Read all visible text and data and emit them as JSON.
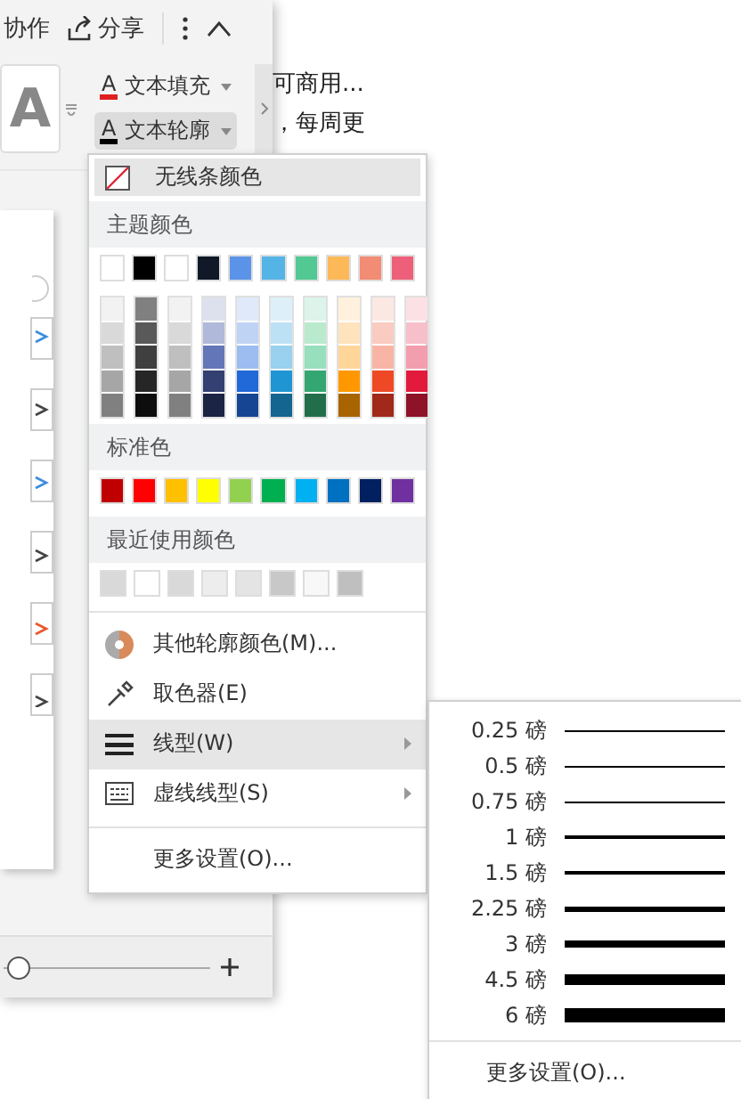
{
  "toolbar": {
    "collab": "协作",
    "share": "分享"
  },
  "text_buttons": [
    {
      "icon": "A",
      "label": "文本填充",
      "color": "#e02020",
      "pressed": false
    },
    {
      "icon": "A",
      "label": "文本轮廓",
      "color": "#000000",
      "pressed": true
    }
  ],
  "preview_glyph": "A",
  "zoom": {
    "level": 0.02
  },
  "background_text": [
    "可商用...",
    "，每周更"
  ],
  "color_menu": {
    "no_line": "无线条颜色",
    "theme_header": "主题颜色",
    "theme_colors": [
      {
        "color": "#ffffff"
      },
      {
        "color": "#000000"
      },
      {
        "color": "#ffffff"
      },
      {
        "color": "#111827"
      },
      {
        "color": "#5b93e8"
      },
      {
        "color": "#55b4e6"
      },
      {
        "color": "#52c892"
      },
      {
        "color": "#fdb857"
      },
      {
        "color": "#f28c74"
      },
      {
        "color": "#ee6079"
      }
    ],
    "shades": [
      [
        {
          "color": "#f2f2f2"
        },
        {
          "color": "#d9d9d9"
        },
        {
          "color": "#bfbfbf"
        },
        {
          "color": "#a6a6a6"
        },
        {
          "color": "#808080"
        }
      ],
      [
        {
          "color": "#808080"
        },
        {
          "color": "#595959"
        },
        {
          "color": "#3f3f3f"
        },
        {
          "color": "#262626"
        },
        {
          "color": "#0d0d0d"
        }
      ],
      [
        {
          "color": "#f2f2f2"
        },
        {
          "color": "#d9d9d9"
        },
        {
          "color": "#bfbfbf"
        },
        {
          "color": "#a6a6a6"
        },
        {
          "color": "#808080"
        }
      ],
      [
        {
          "color": "#dde1ee"
        },
        {
          "color": "#b0b9d9"
        },
        {
          "color": "#6276b8"
        },
        {
          "color": "#334071"
        },
        {
          "color": "#1c2444"
        }
      ],
      [
        {
          "color": "#dfe9f9"
        },
        {
          "color": "#bfd3f5"
        },
        {
          "color": "#9dbdf0"
        },
        {
          "color": "#2168d8"
        },
        {
          "color": "#164594"
        }
      ],
      [
        {
          "color": "#ddf0fa"
        },
        {
          "color": "#bce1f4"
        },
        {
          "color": "#99d1ef"
        },
        {
          "color": "#1f95d3"
        },
        {
          "color": "#146590"
        }
      ],
      [
        {
          "color": "#dcf4e9"
        },
        {
          "color": "#baeace"
        },
        {
          "color": "#97dfbd"
        },
        {
          "color": "#34a672"
        },
        {
          "color": "#226e4b"
        }
      ],
      [
        {
          "color": "#fff1dd"
        },
        {
          "color": "#ffe3bc"
        },
        {
          "color": "#ffd59a"
        },
        {
          "color": "#ff9800"
        },
        {
          "color": "#a86400"
        }
      ],
      [
        {
          "color": "#fce8e3"
        },
        {
          "color": "#facbc0"
        },
        {
          "color": "#f8b5a6"
        },
        {
          "color": "#ee4924"
        },
        {
          "color": "#a0291a"
        }
      ],
      [
        {
          "color": "#fbe0e4"
        },
        {
          "color": "#f7bfc9"
        },
        {
          "color": "#f39eae"
        },
        {
          "color": "#e21b3c"
        },
        {
          "color": "#8e1228"
        }
      ]
    ],
    "standard_header": "标准色",
    "standard_colors": [
      {
        "color": "#c00000"
      },
      {
        "color": "#ff0000"
      },
      {
        "color": "#ffc000"
      },
      {
        "color": "#ffff00"
      },
      {
        "color": "#92d050"
      },
      {
        "color": "#00b050"
      },
      {
        "color": "#00b0f0"
      },
      {
        "color": "#0070c0"
      },
      {
        "color": "#002060"
      },
      {
        "color": "#7030a0"
      }
    ],
    "recent_header": "最近使用颜色",
    "recent_colors": [
      {
        "color": "#d9d9d9"
      },
      {
        "color": "#ffffff"
      },
      {
        "color": "#d9d9d9"
      },
      {
        "color": "#ededed"
      },
      {
        "color": "#e4e4e4"
      },
      {
        "color": "#c8c8c8"
      },
      {
        "color": "#f8f8f8"
      },
      {
        "color": "#bfbfbf"
      }
    ],
    "items": [
      {
        "kind": "palette",
        "label": "其他轮廓颜色(M)...",
        "selected": false,
        "submenu": false
      },
      {
        "kind": "picker",
        "label": "取色器(E)",
        "selected": false,
        "submenu": false
      },
      {
        "kind": "weight",
        "label": "线型(W)",
        "selected": true,
        "submenu": true
      },
      {
        "kind": "dash",
        "label": "虚线线型(S)",
        "selected": false,
        "submenu": true
      },
      {
        "kind": "divider"
      },
      {
        "kind": "plain",
        "label": "更多设置(O)...",
        "selected": false,
        "submenu": false
      }
    ]
  },
  "weight_menu": {
    "items": [
      {
        "label": "0.25 磅"
      },
      {
        "label": "0.5 磅"
      },
      {
        "label": "0.75 磅"
      },
      {
        "label": "1 磅"
      },
      {
        "label": "1.5 磅"
      },
      {
        "label": "2.25 磅"
      },
      {
        "label": "3 磅"
      },
      {
        "label": "4.5 磅"
      },
      {
        "label": "6 磅"
      }
    ],
    "more": "更多设置(O)..."
  }
}
